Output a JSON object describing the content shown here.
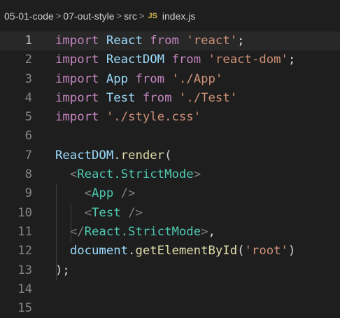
{
  "breadcrumb": {
    "segments": [
      "05-01-code",
      "07-out-style",
      "src"
    ],
    "separator": ">",
    "file_icon_label": "JS",
    "file_name": "index.js"
  },
  "editor": {
    "language": "javascript",
    "active_line": 1,
    "lines": [
      {
        "n": "1",
        "t": [
          [
            "kw",
            "import"
          ],
          [
            "punc",
            " "
          ],
          [
            "id",
            "React"
          ],
          [
            "punc",
            " "
          ],
          [
            "kw",
            "from"
          ],
          [
            "punc",
            " "
          ],
          [
            "str",
            "'react'"
          ],
          [
            "punc",
            ";"
          ]
        ]
      },
      {
        "n": "2",
        "t": [
          [
            "kw",
            "import"
          ],
          [
            "punc",
            " "
          ],
          [
            "id",
            "ReactDOM"
          ],
          [
            "punc",
            " "
          ],
          [
            "kw",
            "from"
          ],
          [
            "punc",
            " "
          ],
          [
            "str",
            "'react-dom'"
          ],
          [
            "punc",
            ";"
          ]
        ]
      },
      {
        "n": "3",
        "t": [
          [
            "kw",
            "import"
          ],
          [
            "punc",
            " "
          ],
          [
            "id",
            "App"
          ],
          [
            "punc",
            " "
          ],
          [
            "kw",
            "from"
          ],
          [
            "punc",
            " "
          ],
          [
            "str",
            "'./App'"
          ]
        ]
      },
      {
        "n": "4",
        "t": [
          [
            "kw",
            "import"
          ],
          [
            "punc",
            " "
          ],
          [
            "id",
            "Test"
          ],
          [
            "punc",
            " "
          ],
          [
            "kw",
            "from"
          ],
          [
            "punc",
            " "
          ],
          [
            "str",
            "'./Test'"
          ]
        ]
      },
      {
        "n": "5",
        "t": [
          [
            "kw",
            "import"
          ],
          [
            "punc",
            " "
          ],
          [
            "str",
            "'./style.css'"
          ]
        ]
      },
      {
        "n": "6",
        "t": []
      },
      {
        "n": "7",
        "t": [
          [
            "id",
            "ReactDOM"
          ],
          [
            "punc",
            "."
          ],
          [
            "fn",
            "render"
          ],
          [
            "punc",
            "("
          ]
        ]
      },
      {
        "n": "8",
        "t": [
          [
            "punc",
            "  "
          ],
          [
            "br",
            "<"
          ],
          [
            "tag",
            "React.StrictMode"
          ],
          [
            "br",
            ">"
          ]
        ]
      },
      {
        "n": "9",
        "t": [
          [
            "punc",
            "    "
          ],
          [
            "br",
            "<"
          ],
          [
            "tag",
            "App"
          ],
          [
            "punc",
            " "
          ],
          [
            "br",
            "/>"
          ]
        ]
      },
      {
        "n": "10",
        "t": [
          [
            "punc",
            "    "
          ],
          [
            "br",
            "<"
          ],
          [
            "tag",
            "Test"
          ],
          [
            "punc",
            " "
          ],
          [
            "br",
            "/>"
          ]
        ]
      },
      {
        "n": "11",
        "t": [
          [
            "punc",
            "  "
          ],
          [
            "br",
            "</"
          ],
          [
            "tag",
            "React.StrictMode"
          ],
          [
            "br",
            ">"
          ],
          [
            "punc",
            ","
          ]
        ]
      },
      {
        "n": "12",
        "t": [
          [
            "punc",
            "  "
          ],
          [
            "id",
            "document"
          ],
          [
            "punc",
            "."
          ],
          [
            "fn",
            "getElementById"
          ],
          [
            "punc",
            "("
          ],
          [
            "str",
            "'root'"
          ],
          [
            "punc",
            ")"
          ]
        ]
      },
      {
        "n": "13",
        "t": [
          [
            "punc",
            ");"
          ]
        ]
      },
      {
        "n": "14",
        "t": []
      },
      {
        "n": "15",
        "t": []
      }
    ]
  },
  "colors": {
    "background": "#1e1e1e",
    "keyword": "#c586c0",
    "variable": "#9cdcfe",
    "string": "#ce9178",
    "function": "#dcdcaa",
    "jsx_tag": "#4ec9b0",
    "jsx_bracket": "#808080",
    "line_number": "#858585"
  }
}
